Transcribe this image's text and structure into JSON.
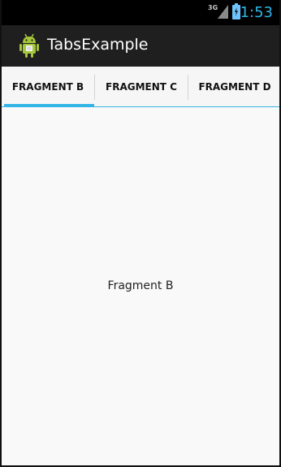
{
  "status_bar": {
    "network": "3G",
    "time": "1:53",
    "icons": [
      "signal-icon",
      "battery-icon"
    ]
  },
  "action_bar": {
    "title": "TabsExample",
    "icon": "android-icon"
  },
  "tabs": [
    {
      "label": "FRAGMENT B",
      "selected": true
    },
    {
      "label": "FRAGMENT C",
      "selected": false
    },
    {
      "label": "FRAGMENT D",
      "selected": false
    }
  ],
  "content": {
    "text": "Fragment B"
  },
  "colors": {
    "accent": "#33b5e5",
    "action_bar": "#1f1f1f",
    "status_time": "#31b6e7"
  }
}
